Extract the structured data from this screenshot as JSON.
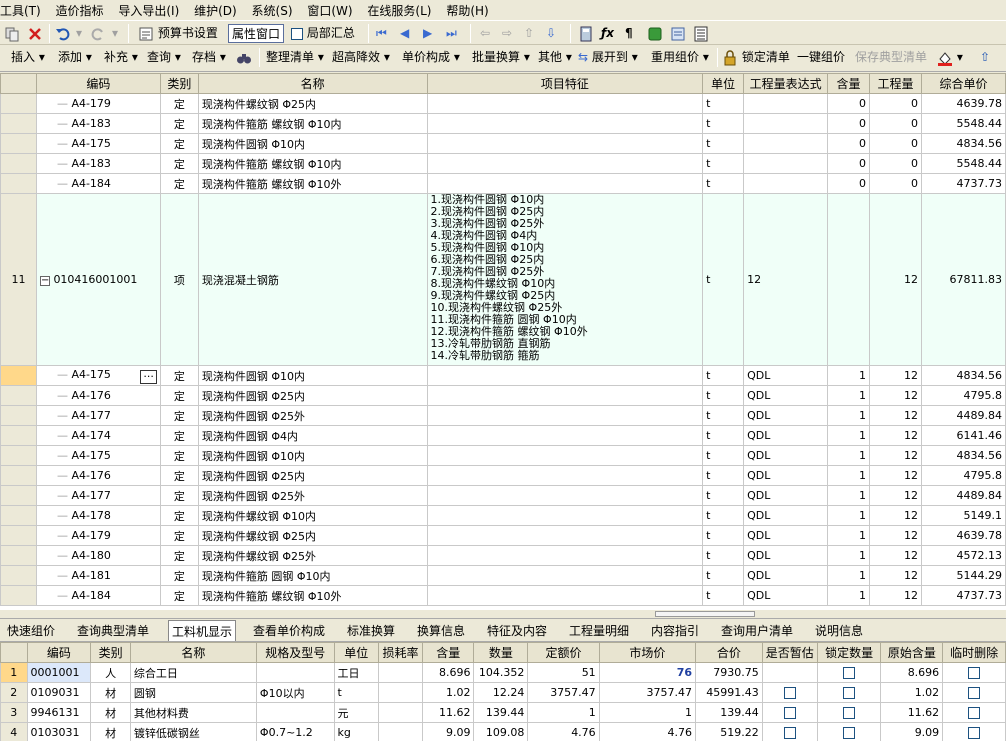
{
  "menu": [
    "工具(T)",
    "造价指标",
    "导入导出(I)",
    "维护(D)",
    "系统(S)",
    "窗口(W)",
    "在线服务(L)",
    "帮助(H)"
  ],
  "toolbar1": {
    "budget_settings": "预算书设置",
    "property_window": "属性窗口",
    "partial_summary": "局部汇总"
  },
  "toolbar2": {
    "items": [
      "插入",
      "添加",
      "补充",
      "查询",
      "存档",
      "整理清单",
      "超高降效",
      "单价构成",
      "批量换算",
      "其他",
      "展开到",
      "重用组价",
      "锁定清单",
      "一键组价",
      "保存典型清单"
    ]
  },
  "grid": {
    "headers": [
      "编码",
      "类别",
      "名称",
      "项目特征",
      "单位",
      "工程量表达式",
      "含量",
      "工程量",
      "综合单价"
    ],
    "top_rows": [
      {
        "code": "A4-179",
        "type": "定",
        "name": "现浇构件螺纹钢 Φ25内",
        "unit": "t",
        "expr": "",
        "content": "0",
        "qty": "0",
        "price": "4639.78"
      },
      {
        "code": "A4-183",
        "type": "定",
        "name": "现浇构件箍筋 螺纹钢 Φ10内",
        "unit": "t",
        "expr": "",
        "content": "0",
        "qty": "0",
        "price": "5548.44"
      },
      {
        "code": "A4-175",
        "type": "定",
        "name": "现浇构件圆钢 Φ10内",
        "unit": "t",
        "expr": "",
        "content": "0",
        "qty": "0",
        "price": "4834.56"
      },
      {
        "code": "A4-183",
        "type": "定",
        "name": "现浇构件箍筋 螺纹钢 Φ10内",
        "unit": "t",
        "expr": "",
        "content": "0",
        "qty": "0",
        "price": "5548.44"
      },
      {
        "code": "A4-184",
        "type": "定",
        "name": "现浇构件箍筋 螺纹钢 Φ10外",
        "unit": "t",
        "expr": "",
        "content": "0",
        "qty": "0",
        "price": "4737.73"
      }
    ],
    "item_row": {
      "rownum": "11",
      "code": "010416001001",
      "type": "项",
      "name": "现浇混凝土钢筋",
      "unit": "t",
      "expr": "12",
      "content": "",
      "qty": "12",
      "price": "67811.83",
      "features": [
        "1.现浇构件圆钢 Φ10内",
        "2.现浇构件圆钢 Φ25内",
        "3.现浇构件圆钢 Φ25外",
        "4.现浇构件圆钢 Φ4内",
        "5.现浇构件圆钢 Φ10内",
        "6.现浇构件圆钢 Φ25内",
        "7.现浇构件圆钢 Φ25外",
        "8.现浇构件螺纹钢 Φ10内",
        "9.现浇构件螺纹钢 Φ25内",
        "10.现浇构件螺纹钢 Φ25外",
        "11.现浇构件箍筋 圆钢 Φ10内",
        "12.现浇构件箍筋 螺纹钢 Φ10外",
        "13.冷轧带肋钢筋 直钢筋",
        "14.冷轧带肋钢筋 箍筋"
      ]
    },
    "sub_rows": [
      {
        "code": "A4-175",
        "type": "定",
        "name": "现浇构件圆钢 Φ10内",
        "unit": "t",
        "expr": "QDL",
        "content": "1",
        "qty": "12",
        "price": "4834.56"
      },
      {
        "code": "A4-176",
        "type": "定",
        "name": "现浇构件圆钢 Φ25内",
        "unit": "t",
        "expr": "QDL",
        "content": "1",
        "qty": "12",
        "price": "4795.8"
      },
      {
        "code": "A4-177",
        "type": "定",
        "name": "现浇构件圆钢 Φ25外",
        "unit": "t",
        "expr": "QDL",
        "content": "1",
        "qty": "12",
        "price": "4489.84"
      },
      {
        "code": "A4-174",
        "type": "定",
        "name": "现浇构件圆钢 Φ4内",
        "unit": "t",
        "expr": "QDL",
        "content": "1",
        "qty": "12",
        "price": "6141.46"
      },
      {
        "code": "A4-175",
        "type": "定",
        "name": "现浇构件圆钢 Φ10内",
        "unit": "t",
        "expr": "QDL",
        "content": "1",
        "qty": "12",
        "price": "4834.56"
      },
      {
        "code": "A4-176",
        "type": "定",
        "name": "现浇构件圆钢 Φ25内",
        "unit": "t",
        "expr": "QDL",
        "content": "1",
        "qty": "12",
        "price": "4795.8"
      },
      {
        "code": "A4-177",
        "type": "定",
        "name": "现浇构件圆钢 Φ25外",
        "unit": "t",
        "expr": "QDL",
        "content": "1",
        "qty": "12",
        "price": "4489.84"
      },
      {
        "code": "A4-178",
        "type": "定",
        "name": "现浇构件螺纹钢 Φ10内",
        "unit": "t",
        "expr": "QDL",
        "content": "1",
        "qty": "12",
        "price": "5149.1"
      },
      {
        "code": "A4-179",
        "type": "定",
        "name": "现浇构件螺纹钢 Φ25内",
        "unit": "t",
        "expr": "QDL",
        "content": "1",
        "qty": "12",
        "price": "4639.78"
      },
      {
        "code": "A4-180",
        "type": "定",
        "name": "现浇构件螺纹钢 Φ25外",
        "unit": "t",
        "expr": "QDL",
        "content": "1",
        "qty": "12",
        "price": "4572.13"
      },
      {
        "code": "A4-181",
        "type": "定",
        "name": "现浇构件箍筋 圆钢 Φ10内",
        "unit": "t",
        "expr": "QDL",
        "content": "1",
        "qty": "12",
        "price": "5144.29"
      },
      {
        "code": "A4-184",
        "type": "定",
        "name": "现浇构件箍筋 螺纹钢 Φ10外",
        "unit": "t",
        "expr": "QDL",
        "content": "1",
        "qty": "12",
        "price": "4737.73"
      }
    ]
  },
  "tabs": {
    "items": [
      "快速组价",
      "查询典型清单",
      "工料机显示",
      "查看单价构成",
      "标准换算",
      "换算信息",
      "特征及内容",
      "工程量明细",
      "内容指引",
      "查询用户清单",
      "说明信息"
    ],
    "active": "工料机显示"
  },
  "bottom": {
    "headers": [
      "编码",
      "类别",
      "名称",
      "规格及型号",
      "单位",
      "损耗率",
      "含量",
      "数量",
      "定额价",
      "市场价",
      "合价",
      "是否暂估",
      "锁定数量",
      "原始含量",
      "临时删除"
    ],
    "rows": [
      {
        "n": "1",
        "code": "0001001",
        "type": "人",
        "name": "综合工日",
        "spec": "",
        "unit": "工日",
        "loss": "",
        "content": "8.696",
        "qty": "104.352",
        "quota": "51",
        "market": "76",
        "total": "7930.75",
        "orig": "8.696"
      },
      {
        "n": "2",
        "code": "0109031",
        "type": "材",
        "name": "圆钢",
        "spec": "Φ10以内",
        "unit": "t",
        "loss": "",
        "content": "1.02",
        "qty": "12.24",
        "quota": "3757.47",
        "market": "3757.47",
        "total": "45991.43",
        "orig": "1.02"
      },
      {
        "n": "3",
        "code": "9946131",
        "type": "材",
        "name": "其他材料费",
        "spec": "",
        "unit": "元",
        "loss": "",
        "content": "11.62",
        "qty": "139.44",
        "quota": "1",
        "market": "1",
        "total": "139.44",
        "orig": "11.62"
      },
      {
        "n": "4",
        "code": "0103031",
        "type": "材",
        "name": "镀锌低碳钢丝",
        "spec": "Φ0.7~1.2",
        "unit": "kg",
        "loss": "",
        "content": "9.09",
        "qty": "109.08",
        "quota": "4.76",
        "market": "4.76",
        "total": "519.22",
        "orig": "9.09"
      }
    ]
  }
}
